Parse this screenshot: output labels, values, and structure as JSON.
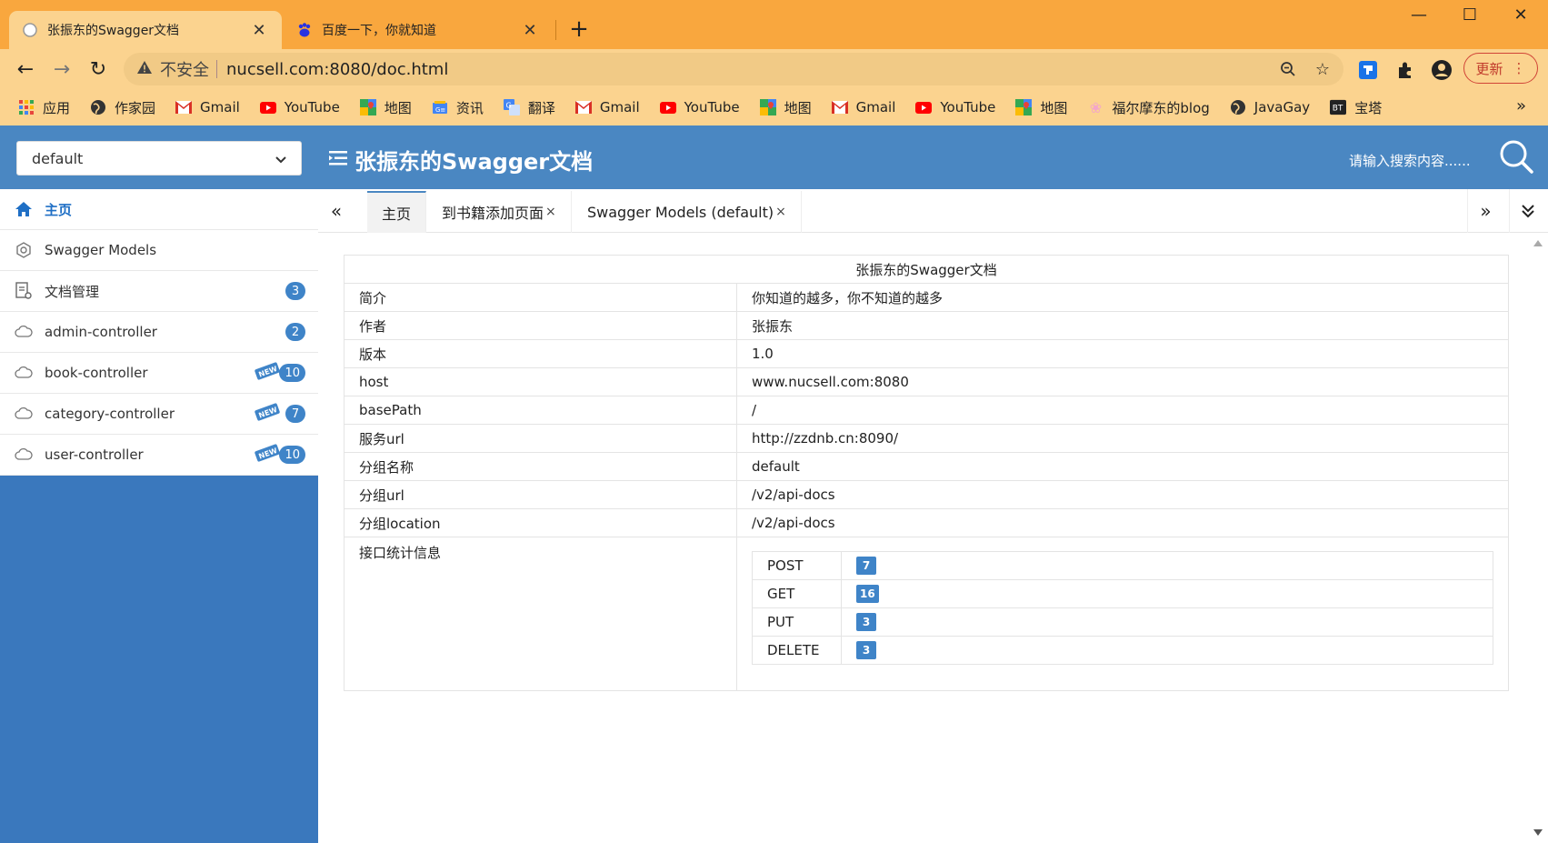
{
  "browser": {
    "tabs": [
      {
        "title": "张振东的Swagger文档",
        "icon": "swagger-page-icon",
        "active": true
      },
      {
        "title": "百度一下，你就知道",
        "icon": "baidu-icon",
        "active": false
      }
    ],
    "new_tab": "+",
    "window_controls": {
      "minimize": "—",
      "maximize": "☐",
      "close": "✕"
    },
    "nav": {
      "back": "←",
      "forward": "→",
      "reload": "↻"
    },
    "address": {
      "insecure_label": "不安全",
      "url": "nucsell.com:8080/doc.html"
    },
    "update_label": "更新",
    "bookmarks": [
      {
        "label": "应用",
        "icon": "apps-grid-icon"
      },
      {
        "label": "作家园",
        "icon": "globe-icon"
      },
      {
        "label": "Gmail",
        "icon": "gmail-icon"
      },
      {
        "label": "YouTube",
        "icon": "youtube-icon"
      },
      {
        "label": "地图",
        "icon": "maps-icon"
      },
      {
        "label": "资讯",
        "icon": "news-icon"
      },
      {
        "label": "翻译",
        "icon": "translate-icon"
      },
      {
        "label": "Gmail",
        "icon": "gmail-icon"
      },
      {
        "label": "YouTube",
        "icon": "youtube-icon"
      },
      {
        "label": "地图",
        "icon": "maps-icon"
      },
      {
        "label": "Gmail",
        "icon": "gmail-icon"
      },
      {
        "label": "YouTube",
        "icon": "youtube-icon"
      },
      {
        "label": "地图",
        "icon": "maps-icon"
      },
      {
        "label": "福尔摩东的blog",
        "icon": "flower-icon"
      },
      {
        "label": "JavaGay",
        "icon": "globe-icon"
      },
      {
        "label": "宝塔",
        "icon": "bt-icon"
      }
    ],
    "bookmarks_more": "»"
  },
  "app": {
    "group_select": {
      "value": "default"
    },
    "title": "张振东的Swagger文档",
    "search_placeholder": "请输入搜索内容......"
  },
  "sidebar": {
    "items": [
      {
        "label": "主页",
        "icon": "home-icon",
        "badge": "",
        "new": false,
        "active": true
      },
      {
        "label": "Swagger Models",
        "icon": "models-icon",
        "badge": "",
        "new": false,
        "active": false
      },
      {
        "label": "文档管理",
        "icon": "document-settings-icon",
        "badge": "3",
        "new": false,
        "active": false
      },
      {
        "label": "admin-controller",
        "icon": "cloud-icon",
        "badge": "2",
        "new": false,
        "active": false
      },
      {
        "label": "book-controller",
        "icon": "cloud-icon",
        "badge": "10",
        "new": true,
        "active": false
      },
      {
        "label": "category-controller",
        "icon": "cloud-icon",
        "badge": "7",
        "new": true,
        "active": false
      },
      {
        "label": "user-controller",
        "icon": "cloud-icon",
        "badge": "10",
        "new": true,
        "active": false
      }
    ],
    "new_tag": "NEW"
  },
  "doc_tabs": {
    "prev": "«",
    "next": "»",
    "collapse": "⌄",
    "items": [
      {
        "label": "主页",
        "closable": false,
        "active": true
      },
      {
        "label": "到书籍添加页面",
        "closable": true,
        "active": false
      },
      {
        "label": "Swagger Models (default)",
        "closable": true,
        "active": false
      }
    ],
    "close_glyph": "×"
  },
  "info": {
    "title": "张振东的Swagger文档",
    "rows": [
      {
        "key": "简介",
        "value": "你知道的越多，你不知道的越多"
      },
      {
        "key": "作者",
        "value": "张振东"
      },
      {
        "key": "版本",
        "value": "1.0"
      },
      {
        "key": "host",
        "value": "www.nucsell.com:8080"
      },
      {
        "key": "basePath",
        "value": "/"
      },
      {
        "key": "服务url",
        "value": "http://zzdnb.cn:8090/"
      },
      {
        "key": "分组名称",
        "value": "default"
      },
      {
        "key": "分组url",
        "value": "/v2/api-docs"
      },
      {
        "key": "分组location",
        "value": "/v2/api-docs"
      }
    ],
    "stats_label": "接口统计信息",
    "stats": [
      {
        "method": "POST",
        "count": "7"
      },
      {
        "method": "GET",
        "count": "16"
      },
      {
        "method": "PUT",
        "count": "3"
      },
      {
        "method": "DELETE",
        "count": "3"
      }
    ]
  },
  "colors": {
    "chrome_orange": "#f9a73e",
    "chrome_light": "#fbd38f",
    "app_blue": "#4a87c2",
    "sidebar_blue": "#3a78bd",
    "badge_blue": "#3f84c8"
  }
}
